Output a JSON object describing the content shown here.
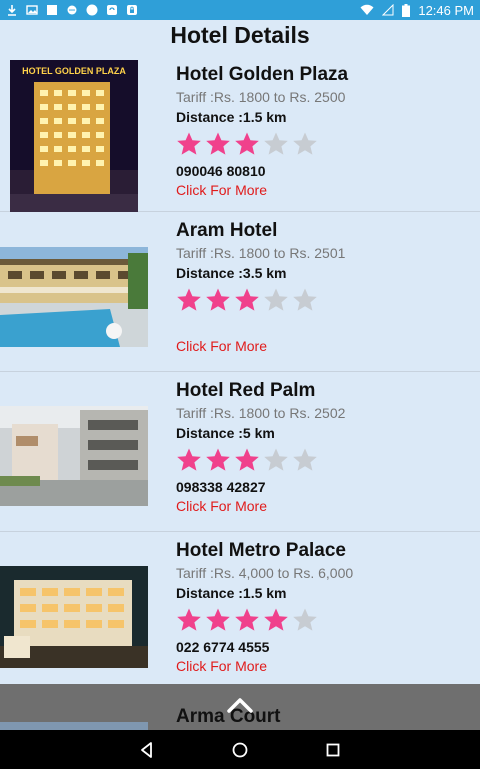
{
  "status_bar": {
    "time": "12:46 PM",
    "icons": [
      "download-icon",
      "image-icon",
      "square-icon",
      "message-icon",
      "circle-icon",
      "sync-icon",
      "lock-icon",
      "wifi-icon",
      "signal-icon",
      "battery-icon"
    ]
  },
  "page": {
    "title": "Hotel Details"
  },
  "hotels": [
    {
      "name": "Hotel Golden Plaza",
      "tariff": "Tariff :Rs. 1800 to Rs. 2500",
      "distance": "Distance :1.5 km",
      "rating": 3,
      "max_rating": 5,
      "phone": "090046 80810",
      "more_label": "Click For More",
      "photo_sign": "HOTEL GOLDEN PLAZA"
    },
    {
      "name": "Aram Hotel",
      "tariff": "Tariff :Rs. 1800 to Rs. 2501",
      "distance": "Distance :3.5 km",
      "rating": 3,
      "max_rating": 5,
      "phone": "",
      "more_label": "Click For More"
    },
    {
      "name": "Hotel Red Palm",
      "tariff": "Tariff :Rs. 1800 to Rs. 2502",
      "distance": "Distance :5 km",
      "rating": 3,
      "max_rating": 5,
      "phone": "098338 42827",
      "more_label": "Click For More"
    },
    {
      "name": "Hotel Metro Palace",
      "tariff": "Tariff :Rs. 4,000 to Rs. 6,000",
      "distance": "Distance :1.5 km",
      "rating": 4,
      "max_rating": 5,
      "phone": "022 6774 4555",
      "more_label": "Click For More"
    },
    {
      "name": "Arma Court"
    }
  ],
  "colors": {
    "status_bar": "#2f9fd8",
    "background": "#dbe9f7",
    "star_filled": "#f0418c",
    "star_empty": "#c7ccd2",
    "link": "#e01b1b"
  },
  "navigation": {
    "buttons": [
      "back-icon",
      "home-icon",
      "recents-icon"
    ]
  }
}
